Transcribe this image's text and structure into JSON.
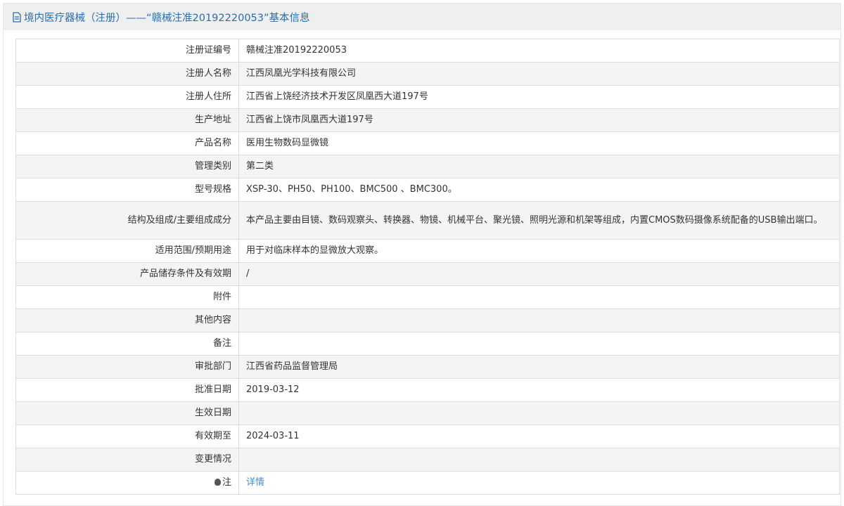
{
  "header": {
    "title": "境内医疗器械（注册）——“赣械注准20192220053”基本信息"
  },
  "rows": [
    {
      "label": "注册证编号",
      "value": "赣械注准20192220053"
    },
    {
      "label": "注册人名称",
      "value": "江西凤凰光学科技有限公司"
    },
    {
      "label": "注册人住所",
      "value": "江西省上饶经济技术开发区凤凰西大道197号"
    },
    {
      "label": "生产地址",
      "value": "江西省上饶市凤凰西大道197号"
    },
    {
      "label": "产品名称",
      "value": "医用生物数码显微镜"
    },
    {
      "label": "管理类别",
      "value": "第二类"
    },
    {
      "label": "型号规格",
      "value": "XSP-30、PH50、PH100、BMC500 、BMC300。"
    },
    {
      "label": "结构及组成/主要组成成分",
      "value": "本产品主要由目镜、数码观察头、转换器、物镜、机械平台、聚光镜、照明光源和机架等组成，内置CMOS数码摄像系统配备的USB输出端口。"
    },
    {
      "label": "适用范围/预期用途",
      "value": "用于对临床样本的显微放大观察。"
    },
    {
      "label": "产品储存条件及有效期",
      "value": "/"
    },
    {
      "label": "附件",
      "value": ""
    },
    {
      "label": "其他内容",
      "value": ""
    },
    {
      "label": "备注",
      "value": ""
    },
    {
      "label": "审批部门",
      "value": "江西省药品监督管理局"
    },
    {
      "label": "批准日期",
      "value": "2019-03-12"
    },
    {
      "label": "生效日期",
      "value": ""
    },
    {
      "label": "有效期至",
      "value": "2024-03-11"
    },
    {
      "label": "变更情况",
      "value": ""
    }
  ],
  "note": {
    "label": "注",
    "link": "详情"
  }
}
